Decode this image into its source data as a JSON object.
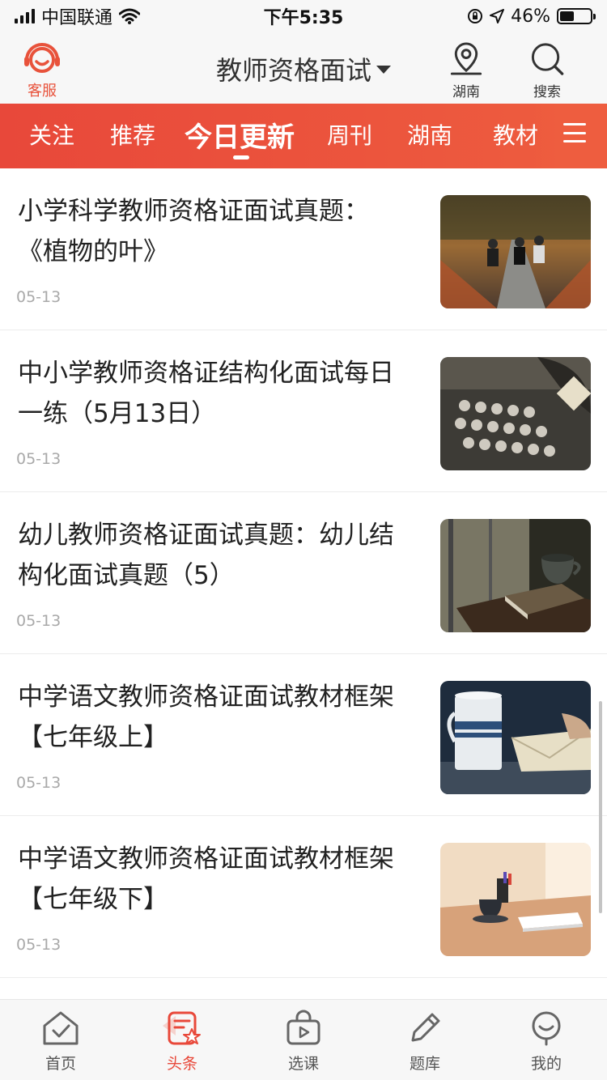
{
  "status_bar": {
    "carrier": "中国联通",
    "time": "下午5:35",
    "battery": "46%",
    "battery_level": 0.46
  },
  "header": {
    "customer_service_label": "客服",
    "title": "教师资格面试",
    "location_label": "湖南",
    "search_label": "搜索"
  },
  "tabs": [
    {
      "label": "关注"
    },
    {
      "label": "推荐"
    },
    {
      "label": "今日更新",
      "active": true
    },
    {
      "label": "周刊"
    },
    {
      "label": "湖南"
    },
    {
      "label": "教材"
    }
  ],
  "articles": [
    {
      "title": "小学科学教师资格证面试真题：《植物的叶》",
      "date": "05-13",
      "thumb": "skateboarders-photo"
    },
    {
      "title": "中小学教师资格证结构化面试每日一练（5月13日）",
      "date": "05-13",
      "thumb": "typewriter-photo"
    },
    {
      "title": "幼儿教师资格证面试真题：幼儿结构化面试真题（5）",
      "date": "05-13",
      "thumb": "coffee-book-photo"
    },
    {
      "title": "中学语文教师资格证面试教材框架【七年级上】",
      "date": "05-13",
      "thumb": "mug-notebook-photo"
    },
    {
      "title": "中学语文教师资格证面试教材框架【七年级下】",
      "date": "05-13",
      "thumb": "desk-cup-photo"
    }
  ],
  "bottom_nav": [
    {
      "label": "首页",
      "icon": "home-icon"
    },
    {
      "label": "头条",
      "icon": "news-icon",
      "active": true
    },
    {
      "label": "选课",
      "icon": "course-bag-icon"
    },
    {
      "label": "题库",
      "icon": "pencil-icon"
    },
    {
      "label": "我的",
      "icon": "profile-icon"
    }
  ],
  "colors": {
    "accent": "#e8483a",
    "date_gray": "#a9a9a9"
  }
}
